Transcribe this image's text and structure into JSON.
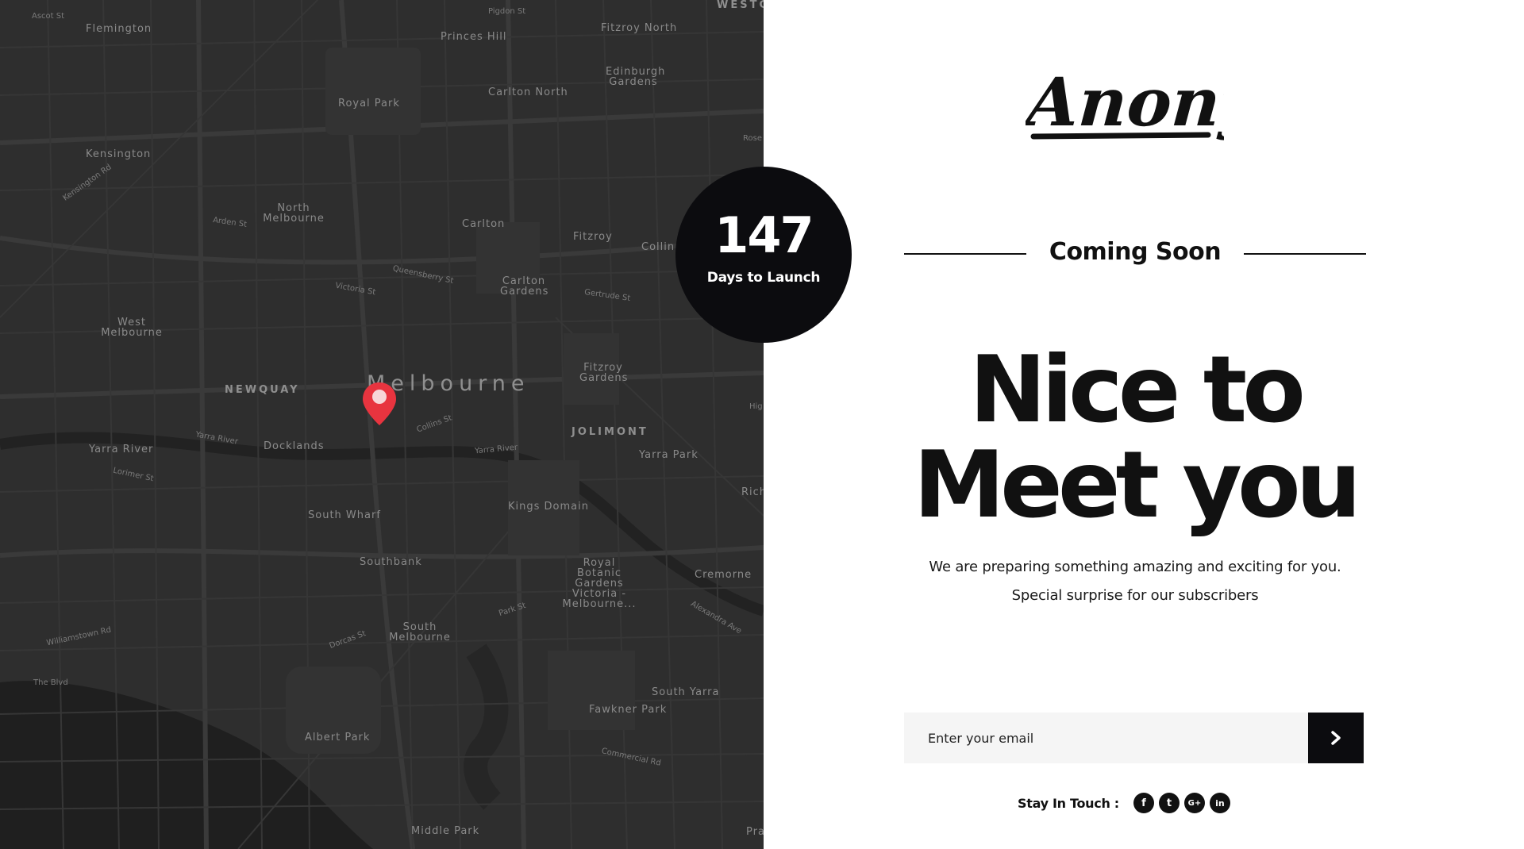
{
  "map": {
    "labels": [
      {
        "text": "Ascot St",
        "cls": "small"
      },
      {
        "text": "Flemington",
        "cls": ""
      },
      {
        "text": "Princes Hill",
        "cls": ""
      },
      {
        "text": "Pigdon St",
        "cls": "small"
      },
      {
        "text": "Fitzroy North",
        "cls": ""
      },
      {
        "text": "WESTG",
        "cls": "caps"
      },
      {
        "text": "Edinburgh Gardens",
        "cls": ""
      },
      {
        "text": "Carlton North",
        "cls": ""
      },
      {
        "text": "Royal Park",
        "cls": ""
      },
      {
        "text": "Kensington",
        "cls": ""
      },
      {
        "text": "North Melbourne",
        "cls": ""
      },
      {
        "text": "Carlton",
        "cls": ""
      },
      {
        "text": "Fitzroy",
        "cls": ""
      },
      {
        "text": "Collin",
        "cls": ""
      },
      {
        "text": "Carlton Gardens",
        "cls": ""
      },
      {
        "text": "West Melbourne",
        "cls": ""
      },
      {
        "text": "NEWQUAY",
        "cls": "caps"
      },
      {
        "text": "Melbourne",
        "cls": "city"
      },
      {
        "text": "Fitzroy Gardens",
        "cls": ""
      },
      {
        "text": "JOLIMONT",
        "cls": "caps"
      },
      {
        "text": "Yarra River",
        "cls": ""
      },
      {
        "text": "Yarra River",
        "cls": "small"
      },
      {
        "text": "Docklands",
        "cls": ""
      },
      {
        "text": "Yarra River",
        "cls": "small"
      },
      {
        "text": "Yarra Park",
        "cls": ""
      },
      {
        "text": "Rich",
        "cls": ""
      },
      {
        "text": "South Wharf",
        "cls": ""
      },
      {
        "text": "Kings Domain",
        "cls": ""
      },
      {
        "text": "Southbank",
        "cls": ""
      },
      {
        "text": "Royal Botanic Gardens Victoria - Melbourne...",
        "cls": ""
      },
      {
        "text": "Cremorne",
        "cls": ""
      },
      {
        "text": "South Melbourne",
        "cls": ""
      },
      {
        "text": "Williamstown Rd",
        "cls": "small"
      },
      {
        "text": "South Yarra",
        "cls": ""
      },
      {
        "text": "Fawkner Park",
        "cls": ""
      },
      {
        "text": "The Blvd",
        "cls": "small"
      },
      {
        "text": "Albert Park",
        "cls": ""
      },
      {
        "text": "Middle Park",
        "cls": ""
      },
      {
        "text": "Pra",
        "cls": ""
      },
      {
        "text": "Collins St",
        "cls": "small"
      },
      {
        "text": "Lorimer St",
        "cls": "small"
      },
      {
        "text": "Victoria St",
        "cls": "small"
      },
      {
        "text": "Queensberry St",
        "cls": "small"
      },
      {
        "text": "Arden St",
        "cls": "small"
      },
      {
        "text": "Kensington Rd",
        "cls": "small"
      },
      {
        "text": "Gertrude St",
        "cls": "small"
      },
      {
        "text": "Commercial Rd",
        "cls": "small"
      },
      {
        "text": "Park St",
        "cls": "small"
      },
      {
        "text": "Dorcas St",
        "cls": "small"
      },
      {
        "text": "Alexandra Ave",
        "cls": "small"
      },
      {
        "text": "Rose",
        "cls": "small"
      },
      {
        "text": "Hig",
        "cls": "small"
      }
    ]
  },
  "countdown": {
    "number": "147",
    "label": "Days to Launch"
  },
  "brand": {
    "logo_text": "Anony"
  },
  "coming_soon": "Coming Soon",
  "headline": {
    "line1": "Nice to",
    "line2": "Meet you"
  },
  "subtitle": {
    "line1": "We are preparing something amazing and exciting for you.",
    "line2": "Special surprise for our subscribers"
  },
  "subscribe": {
    "placeholder": "Enter your email",
    "submit_icon": "chevron-right-icon"
  },
  "social": {
    "label": "Stay In Touch :",
    "items": [
      {
        "name": "facebook-icon",
        "glyph": "f"
      },
      {
        "name": "twitter-icon",
        "glyph": "t"
      },
      {
        "name": "google-plus-icon",
        "glyph": "G+"
      },
      {
        "name": "linkedin-icon",
        "glyph": "in"
      }
    ]
  },
  "colors": {
    "map_bg": "#2e2e2e",
    "pin": "#e8343f",
    "ink": "#111111",
    "circle": "#0c0c0f"
  }
}
